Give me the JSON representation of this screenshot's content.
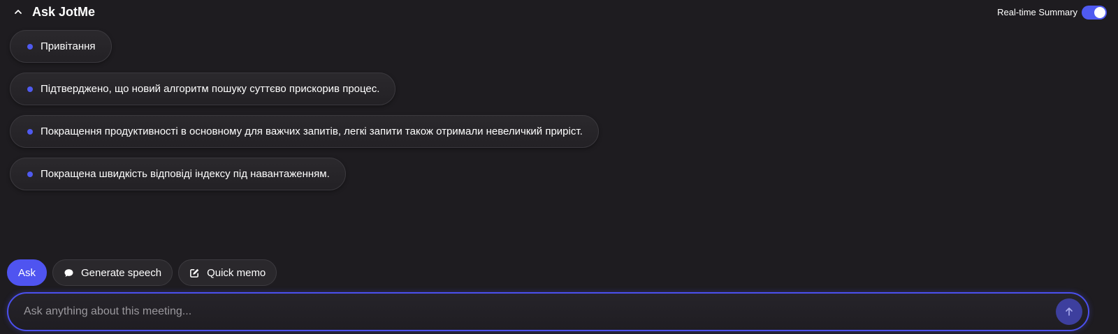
{
  "header": {
    "title": "Ask JotMe",
    "realtime_label": "Real-time Summary",
    "realtime_enabled": true,
    "collapse_icon": "chevron-up-icon"
  },
  "summary": {
    "items": [
      {
        "text": "Привітання"
      },
      {
        "text": "Підтверджено, що новий алгоритм пошуку суттєво прискорив процес."
      },
      {
        "text": "Покращення продуктивності в основному для важчих запитів, легкі запити також отримали невеличкий приріст."
      },
      {
        "text": "Покращена швидкість відповіді індексу під навантаженням."
      }
    ]
  },
  "actions": {
    "ask_label": "Ask",
    "generate_speech_label": "Generate speech",
    "generate_speech_icon": "speech-bubble-icon",
    "quick_memo_label": "Quick memo",
    "quick_memo_icon": "edit-icon"
  },
  "input": {
    "placeholder": "Ask anything about this meeting...",
    "value": "",
    "send_icon": "arrow-up-icon"
  },
  "colors": {
    "accent": "#4f54f0",
    "background": "#1e1c20"
  }
}
